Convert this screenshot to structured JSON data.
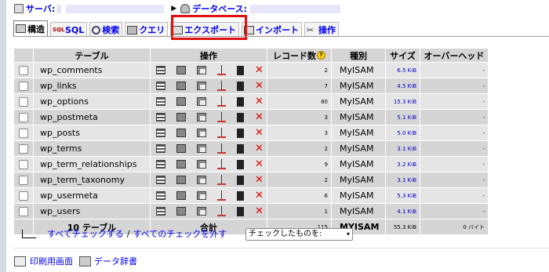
{
  "breadcrumb": {
    "server_label": "サーバ:",
    "database_label": "データベース:"
  },
  "tabs": [
    {
      "label": "構造",
      "icon": "structure-icon",
      "active": true
    },
    {
      "label": "SQL",
      "icon": "sql-icon",
      "active": false
    },
    {
      "label": "検索",
      "icon": "search-icon",
      "active": false
    },
    {
      "label": "クエリ",
      "icon": "query-icon",
      "active": false
    },
    {
      "label": "エクスポート",
      "icon": "export-icon",
      "active": false,
      "highlighted": true,
      "highlight_color": "#e01010"
    },
    {
      "label": "インポート",
      "icon": "import-icon",
      "active": false
    },
    {
      "label": "操作",
      "icon": "operations-icon",
      "active": false
    }
  ],
  "table": {
    "headers": {
      "table": "テーブル",
      "actions": "操作",
      "records": "レコード数",
      "type": "種別",
      "size": "サイズ",
      "overhead": "オーバーヘッド"
    },
    "action_icons": [
      "browse-icon",
      "select-icon",
      "insert-icon",
      "properties-icon",
      "empty-icon",
      "drop-icon"
    ],
    "rows": [
      {
        "name": "wp_comments",
        "records": "2",
        "type": "MyISAM",
        "size": "6.5 KiB",
        "overhead": "-"
      },
      {
        "name": "wp_links",
        "records": "7",
        "type": "MyISAM",
        "size": "4.5 KiB",
        "overhead": "-"
      },
      {
        "name": "wp_options",
        "records": "80",
        "type": "MyISAM",
        "size": "15.3 KiB",
        "overhead": "-"
      },
      {
        "name": "wp_postmeta",
        "records": "3",
        "type": "MyISAM",
        "size": "5.1 KiB",
        "overhead": "-"
      },
      {
        "name": "wp_posts",
        "records": "3",
        "type": "MyISAM",
        "size": "5.0 KiB",
        "overhead": "-"
      },
      {
        "name": "wp_terms",
        "records": "2",
        "type": "MyISAM",
        "size": "3.1 KiB",
        "overhead": "-"
      },
      {
        "name": "wp_term_relationships",
        "records": "9",
        "type": "MyISAM",
        "size": "3.2 KiB",
        "overhead": "-"
      },
      {
        "name": "wp_term_taxonomy",
        "records": "2",
        "type": "MyISAM",
        "size": "3.1 KiB",
        "overhead": "-"
      },
      {
        "name": "wp_usermeta",
        "records": "6",
        "type": "MyISAM",
        "size": "5.3 KiB",
        "overhead": "-"
      },
      {
        "name": "wp_users",
        "records": "1",
        "type": "MyISAM",
        "size": "4.1 KiB",
        "overhead": "-"
      }
    ],
    "footer": {
      "count": "10 テーブル",
      "sum_label": "合計",
      "records": "115",
      "type": "MYISAM",
      "size": "55.3 KiB",
      "overhead": "0 バイト"
    }
  },
  "bulk": {
    "check_all": "すべてチェックする",
    "separator": "/",
    "uncheck_all": "すべてのチェックを外す",
    "with_selected": "チェックしたものを:"
  },
  "bottom": {
    "print_view": "印刷用画面",
    "data_dictionary": "データ辞書"
  }
}
